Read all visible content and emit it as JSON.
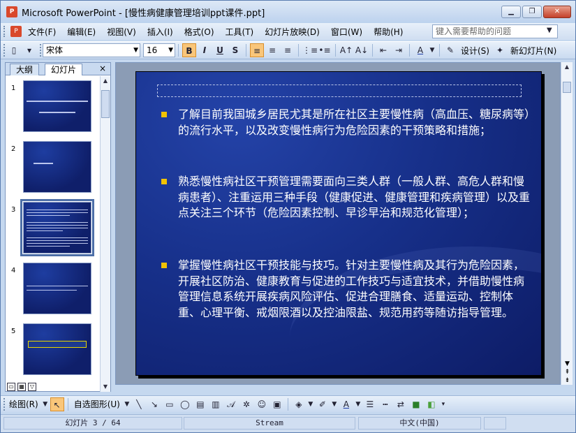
{
  "window": {
    "title": "Microsoft PowerPoint - [慢性病健康管理培训ppt课件.ppt]",
    "app_icon": "powerpoint-icon",
    "buttons": [
      "minimize-icon",
      "restore-icon",
      "close-icon"
    ]
  },
  "menu": {
    "items": [
      "文件(F)",
      "编辑(E)",
      "视图(V)",
      "插入(I)",
      "格式(O)",
      "工具(T)",
      "幻灯片放映(D)",
      "窗口(W)",
      "帮助(H)"
    ],
    "help_placeholder": "键入需要帮助的问题"
  },
  "toolbar": {
    "font_name": "宋体",
    "font_size": "16",
    "bold": "B",
    "italic": "I",
    "underline": "U",
    "shadow": "S",
    "design_label": "设计(S)",
    "new_slide_label": "新幻灯片(N)"
  },
  "left_panel": {
    "tabs": [
      "大纲",
      "幻灯片"
    ],
    "active_tab": "幻灯片",
    "close": "×",
    "slide_numbers": [
      "1",
      "2",
      "3",
      "4",
      "5"
    ],
    "selected_slide": "3"
  },
  "slide": {
    "bullets": [
      "了解目前我国城乡居民尤其是所在社区主要慢性病（高血压、糖尿病等）的流行水平，以及改变慢性病行为危险因素的干预策略和措施；",
      "熟悉慢性病社区干预管理需要面向三类人群（一般人群、高危人群和慢病患者）、注重运用三种手段（健康促进、健康管理和疾病管理）以及重点关注三个环节（危险因素控制、早诊早治和规范化管理）；",
      "掌握慢性病社区干预技能与技巧。针对主要慢性病及其行为危险因素，开展社区防治、健康教育与促进的工作技巧与适宜技术，并借助慢性病管理信息系统开展疾病风险评估、促进合理膳食、适量运动、控制体重、心理平衡、戒烟限酒以及控油限盐、规范用药等随访指导管理。"
    ],
    "bullet_color": "#f2c200"
  },
  "drawbar": {
    "draw_label": "绘图(R)",
    "autoshapes_label": "自选图形(U)"
  },
  "status": {
    "slide_pos": "幻灯片 3 / 64",
    "design": "Stream",
    "language": "中文(中国)"
  }
}
